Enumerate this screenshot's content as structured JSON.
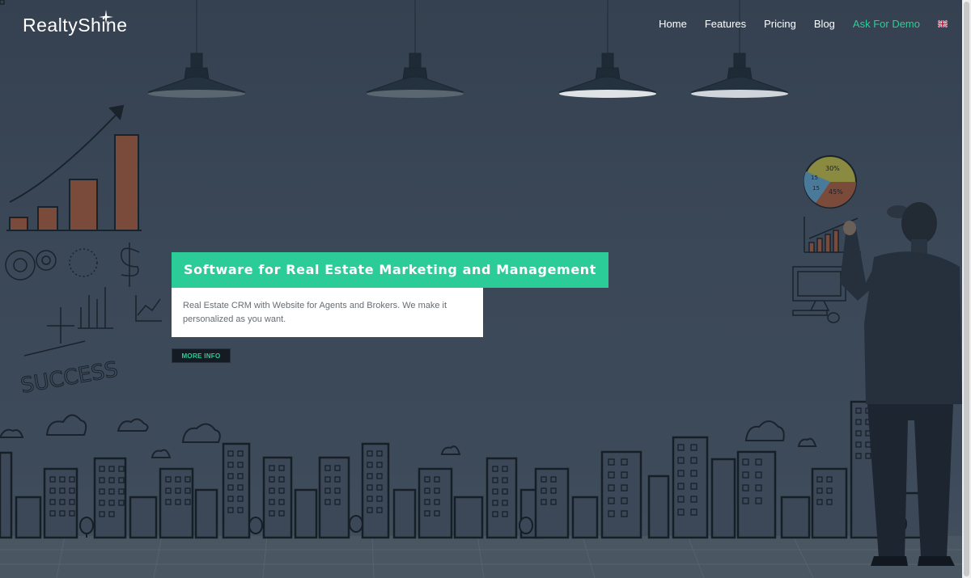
{
  "brand": {
    "logo_text": "RealtyShine"
  },
  "nav": {
    "items": [
      {
        "label": "Home"
      },
      {
        "label": "Features"
      },
      {
        "label": "Pricing"
      },
      {
        "label": "Blog"
      },
      {
        "label": "Ask For Demo"
      }
    ],
    "language_flag": "uk-flag-icon"
  },
  "hero": {
    "headline": "Software for Real Estate Marketing and Management",
    "description": "Real Estate CRM with Website for Agents and Brokers. We make it personalized as you want.",
    "button_label": "MORE INFO",
    "doodle_text": "SUCCESS",
    "pie_labels": [
      "30%",
      "45%",
      "15",
      "15"
    ]
  },
  "colors": {
    "accent": "#2ccc99",
    "background": "#3a4654",
    "button_bg": "#141b22"
  }
}
